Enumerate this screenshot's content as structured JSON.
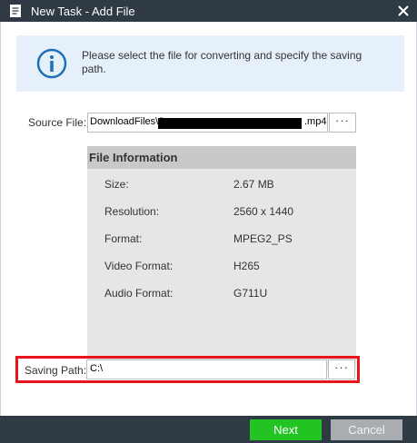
{
  "window": {
    "title": "New Task - Add File",
    "doc_icon": "document-icon",
    "close_icon": "close-icon"
  },
  "info": {
    "icon": "info-icon",
    "text": "Please select the file for converting and specify the saving path."
  },
  "source": {
    "label": "Source File:",
    "path_start": "DownloadFiles\\2",
    "path_end": ".mp4",
    "browse_label": "···"
  },
  "file_info": {
    "title": "File Information",
    "rows": [
      {
        "key": "Size:",
        "value": "2.67 MB"
      },
      {
        "key": "Resolution:",
        "value": "2560 x 1440"
      },
      {
        "key": "Format:",
        "value": "MPEG2_PS"
      },
      {
        "key": "Video Format:",
        "value": "H265"
      },
      {
        "key": "Audio Format:",
        "value": "G711U"
      }
    ]
  },
  "saving": {
    "label": "Saving Path:",
    "value": "C:\\",
    "browse_label": "···"
  },
  "buttons": {
    "next": "Next",
    "cancel": "Cancel"
  },
  "colors": {
    "titlebar": "#2f3a44",
    "banner": "#e6f0fa",
    "highlight": "#e8141b",
    "next": "#22c322",
    "cancel": "#a9adb2"
  }
}
